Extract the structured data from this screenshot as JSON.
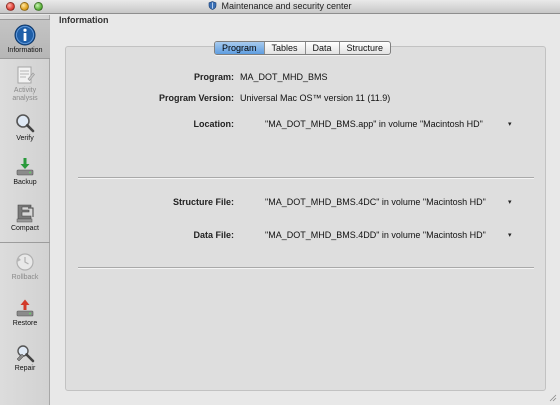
{
  "window": {
    "title": "Maintenance and security center"
  },
  "sidebar": {
    "items": [
      {
        "label": "Information",
        "icon": "information-icon",
        "selected": true,
        "disabled": false
      },
      {
        "label": "Activity analysis",
        "icon": "activity-analysis-icon",
        "selected": false,
        "disabled": true
      },
      {
        "label": "Verify",
        "icon": "magnifier-icon",
        "selected": false,
        "disabled": false
      },
      {
        "label": "Backup",
        "icon": "backup-icon",
        "selected": false,
        "disabled": false
      },
      {
        "label": "Compact",
        "icon": "compact-icon",
        "selected": false,
        "disabled": false
      },
      {
        "label": "Rollback",
        "icon": "rollback-icon",
        "selected": false,
        "disabled": true
      },
      {
        "label": "Restore",
        "icon": "restore-icon",
        "selected": false,
        "disabled": false
      },
      {
        "label": "Repair",
        "icon": "repair-icon",
        "selected": false,
        "disabled": false
      }
    ]
  },
  "main": {
    "section_title": "Information",
    "tabs": [
      {
        "label": "Program",
        "active": true
      },
      {
        "label": "Tables",
        "active": false
      },
      {
        "label": "Data",
        "active": false
      },
      {
        "label": "Structure",
        "active": false
      }
    ],
    "program": {
      "program_label": "Program:",
      "program_value": "MA_DOT_MHD_BMS",
      "version_label": "Program Version:",
      "version_value": "Universal Mac OS™ version 11 (11.9)",
      "location_label": "Location:",
      "location_value": "\"MA_DOT_MHD_BMS.app\" in volume \"Macintosh HD\"",
      "structure_label": "Structure File:",
      "structure_value": "\"MA_DOT_MHD_BMS.4DC\" in volume \"Macintosh HD\"",
      "data_label": "Data File:",
      "data_value": "\"MA_DOT_MHD_BMS.4DD\" in volume \"Macintosh HD\""
    }
  },
  "colors": {
    "active_tab": "#5e9de0",
    "info_icon": "#1f5fa8",
    "backup_icon": "#2a9a3c",
    "restore_icon": "#d23b2a"
  }
}
